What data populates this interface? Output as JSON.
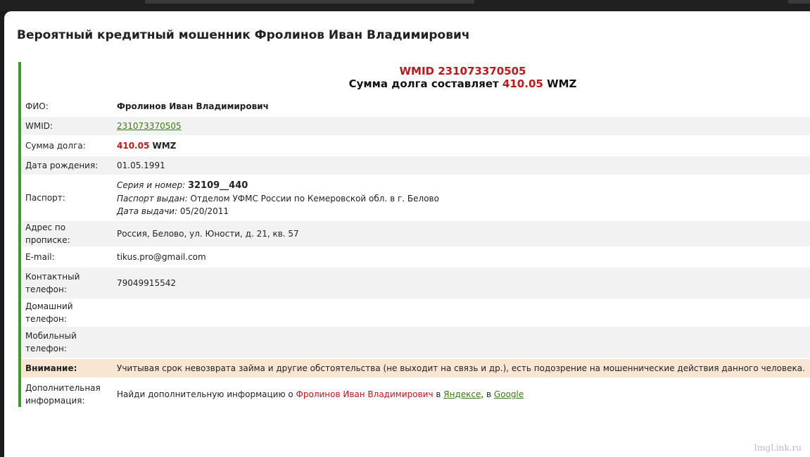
{
  "title": "Вероятный кредитный мошенник Фролинов Иван Владимирович",
  "summary": {
    "wmid_line": "WMID 231073370505",
    "debt_prefix": "Сумма долга составляет",
    "debt_amount": "410.05",
    "debt_currency": "WMZ"
  },
  "rows": {
    "fio": {
      "label": "ФИО:",
      "value": "Фролинов Иван Владимирович"
    },
    "wmid": {
      "label": "WMID:",
      "value": "231073370505"
    },
    "debt": {
      "label": "Сумма долга:",
      "amount": "410.05",
      "currency": "WMZ"
    },
    "birth": {
      "label": "Дата рождения:",
      "value": "01.05.1991"
    },
    "passport": {
      "label": "Паспорт:",
      "series_label": "Серия и номер:",
      "series_value": "32109__440",
      "issued_label": "Паспорт выдан:",
      "issued_value": "Отделом УФМС России по Кемеровской обл. в г. Белово",
      "date_label": "Дата выдачи:",
      "date_value": "05/20/2011"
    },
    "address": {
      "label": "Адрес по прописке:",
      "value": "Россия, Белово, ул. Юности, д. 21, кв. 57"
    },
    "email": {
      "label": "E-mail:",
      "value": "tikus.pro@gmail.com"
    },
    "contact_phone": {
      "label": "Контактный телефон:",
      "value": "79049915542"
    },
    "home_phone": {
      "label": "Домашний телефон:",
      "value": ""
    },
    "mobile_phone": {
      "label": "Мобильный телефон:",
      "value": ""
    },
    "warning": {
      "label": "Внимание:",
      "value": "Учитывая срок невозврата займа и другие обстоятельства (не выходит на связь и др.), есть подозрение на мошеннические действия данного человека."
    },
    "extra": {
      "label": "Дополнительная информация:",
      "prefix": "Найди дополнительную информацию о",
      "name": "Фролинов Иван Владимирович",
      "in1": "в",
      "yandex": "Яндексе",
      "sep": ", в",
      "google": "Google"
    }
  },
  "watermark": "ImgLink.ru"
}
